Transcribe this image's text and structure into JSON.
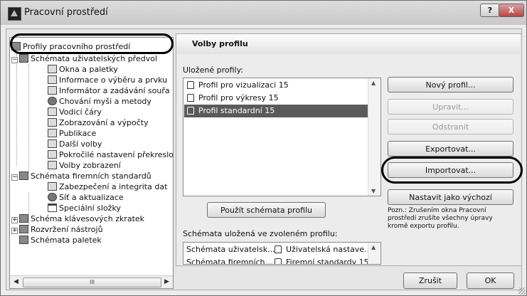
{
  "window": {
    "title": "Pracovní prostředí",
    "help_label": "?",
    "close_label": "X"
  },
  "tree": {
    "items": [
      {
        "label": "Profily pracovního prostředí",
        "icon": "profiles-icon"
      },
      {
        "label": "Schémata uživatelských předvol",
        "icon": "user-schemes-icon"
      },
      {
        "label": "Okna a paletky",
        "icon": "window-icon"
      },
      {
        "label": "Informace o výběru a prvku",
        "icon": "info-icon"
      },
      {
        "label": "Informátor a zadávání souřa",
        "icon": "tracker-icon"
      },
      {
        "label": "Chování myši a metody",
        "icon": "mouse-icon"
      },
      {
        "label": "Vodicí čáry",
        "icon": "guide-lines-icon"
      },
      {
        "label": "Zobrazování a výpočty",
        "icon": "display-icon"
      },
      {
        "label": "Publikace",
        "icon": "publish-icon"
      },
      {
        "label": "Další volby",
        "icon": "more-options-icon"
      },
      {
        "label": "Pokročilé nastavení překreslo",
        "icon": "advanced-icon"
      },
      {
        "label": "Volby zobrazení",
        "icon": "view-options-icon"
      },
      {
        "label": "Schémata firemních standardů",
        "icon": "company-schemes-icon"
      },
      {
        "label": "Zabezpečení a integrita dat",
        "icon": "security-icon"
      },
      {
        "label": "Síť a aktualizace",
        "icon": "network-icon"
      },
      {
        "label": "Speciální složky",
        "icon": "folder-icon"
      },
      {
        "label": "Schéma klávesových zkratek",
        "icon": "shortcuts-icon"
      },
      {
        "label": "Rozvržení nástrojů",
        "icon": "tools-icon"
      },
      {
        "label": "Schémata paletek",
        "icon": "palette-icon"
      }
    ],
    "scroll_thumb_label": "III"
  },
  "panel": {
    "title": "Volby profilu",
    "saved_profiles_label": "Uložené profily:",
    "profiles": [
      {
        "label": "Profil pro vizualizaci 15",
        "selected": false
      },
      {
        "label": "Profil pro výkresy 15",
        "selected": false
      },
      {
        "label": "Profil standardní 15",
        "selected": true
      }
    ],
    "apply_button": "Použít schémata profilu",
    "schemes_label": "Schémata uložená ve zvoleném profilu:",
    "schemes": [
      {
        "name": "Schémata uživatelsk...",
        "value": "Uživatelská nastave..."
      },
      {
        "name": "Schémata firemních...",
        "value": "Firemní standardy 15"
      }
    ]
  },
  "buttons": {
    "new_profile": "Nový profil...",
    "edit": "Upravit...",
    "delete": "Odstranit",
    "export": "Exportovat...",
    "import": "Importovat...",
    "set_default": "Nastavit jako výchozí"
  },
  "note": "Pozn.: Zrušením okna Pracovní prostředí zrušíte všechny úpravy kromě exportu profilu.",
  "footer": {
    "cancel": "Zrušit",
    "ok": "OK"
  }
}
